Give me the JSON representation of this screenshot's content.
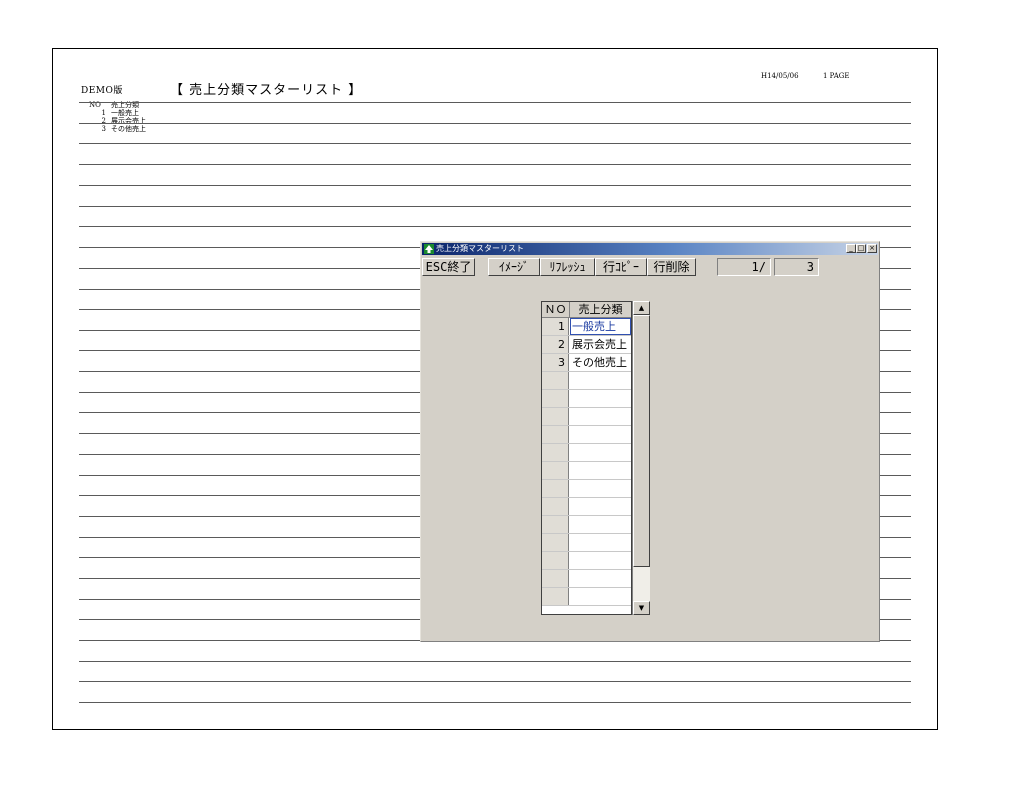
{
  "report": {
    "edition": "DEMO版",
    "title": "【 売上分類マスターリスト 】",
    "date": "H14/05/06",
    "page": "1 PAGE",
    "header": {
      "no": "NO",
      "category": "売上分類"
    },
    "rows": [
      {
        "no": "1",
        "category": "一般売上"
      },
      {
        "no": "2",
        "category": "展示会売上"
      },
      {
        "no": "3",
        "category": "その他売上"
      }
    ]
  },
  "window": {
    "title": "売上分類マスターリスト",
    "controls": {
      "minimize": "_",
      "maximize": "□",
      "close": "×"
    },
    "toolbar": {
      "exit": "ESC終了",
      "image": "ｲﾒｰｼﾞ",
      "refresh": "ﾘﾌﾚｯｼｭ",
      "copy_row": "行ｺﾋﾟｰ",
      "delete_row": "行削除"
    },
    "pager": {
      "current": "1/",
      "total": "3"
    }
  },
  "grid": {
    "headers": {
      "no": "ＮＯ",
      "category": "売上分類"
    },
    "rows": [
      {
        "no": "1",
        "category": "一般売上",
        "selected": true
      },
      {
        "no": "2",
        "category": "展示会売上"
      },
      {
        "no": "3",
        "category": "その他売上"
      },
      {
        "no": "",
        "category": ""
      },
      {
        "no": "",
        "category": ""
      },
      {
        "no": "",
        "category": ""
      },
      {
        "no": "",
        "category": ""
      },
      {
        "no": "",
        "category": ""
      },
      {
        "no": "",
        "category": ""
      },
      {
        "no": "",
        "category": ""
      },
      {
        "no": "",
        "category": ""
      },
      {
        "no": "",
        "category": ""
      },
      {
        "no": "",
        "category": ""
      },
      {
        "no": "",
        "category": ""
      },
      {
        "no": "",
        "category": ""
      },
      {
        "no": "",
        "category": ""
      }
    ],
    "scroll": {
      "up": "▲",
      "down": "▼"
    }
  },
  "colors": {
    "title_bar_start": "#0a246a",
    "title_bar_end": "#c8d4e6",
    "window_bg": "#d4d0c8",
    "selected_text": "#1a3aa0"
  }
}
